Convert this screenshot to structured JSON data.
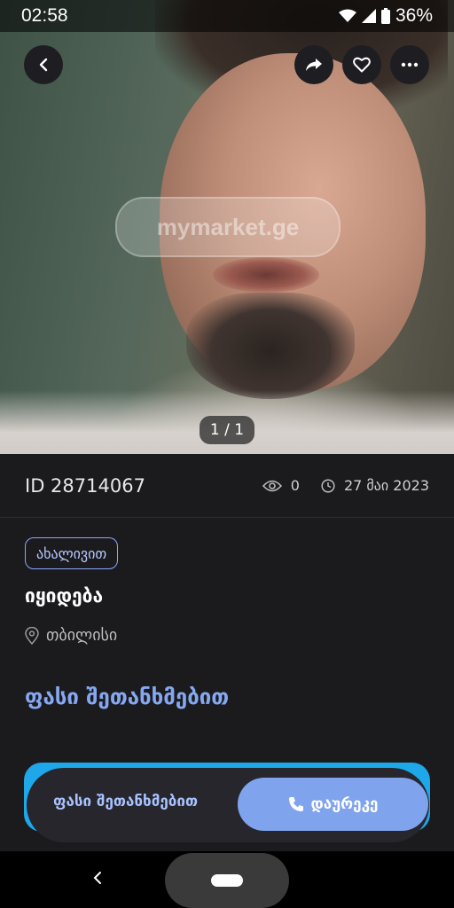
{
  "status_bar": {
    "time": "02:58",
    "battery": "36%"
  },
  "gallery": {
    "counter": "1 / 1",
    "watermark": "mymarket.ge"
  },
  "listing": {
    "id": "ID 28714067",
    "views": "0",
    "date": "27 მაი 2023",
    "condition_badge": "ახალივით",
    "title": "იყიდება",
    "location": "თბილისი",
    "price": "ფასი შეთანხმებით"
  },
  "bottom_bar": {
    "price": "ფასი შეთანხმებით",
    "call_label": "დაურეკე"
  },
  "colors": {
    "accent": "#86a8f0",
    "call_button": "#7fa3ec",
    "cta_border": "#1ea7e9"
  },
  "icons": [
    "back-arrow-icon",
    "share-icon",
    "heart-icon",
    "more-icon",
    "eye-icon",
    "clock-icon",
    "location-pin-icon",
    "phone-icon"
  ]
}
